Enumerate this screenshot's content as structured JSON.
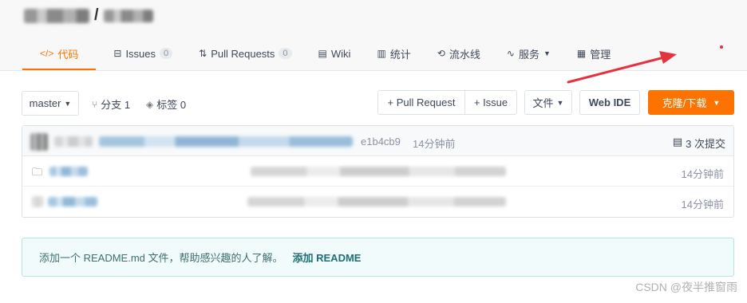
{
  "repo": {
    "separator": "/"
  },
  "tabs": [
    {
      "icon": "code-icon",
      "glyph": "</>",
      "label": "代码",
      "active": true
    },
    {
      "icon": "issues-icon",
      "glyph": "⊟",
      "label": "Issues",
      "count": "0"
    },
    {
      "icon": "pull-request-icon",
      "glyph": "⇅",
      "label": "Pull Requests",
      "count": "0"
    },
    {
      "icon": "wiki-icon",
      "glyph": "▤",
      "label": "Wiki"
    },
    {
      "icon": "stats-icon",
      "glyph": "▥",
      "label": "统计"
    },
    {
      "icon": "pipeline-icon",
      "glyph": "⟲",
      "label": "流水线"
    },
    {
      "icon": "service-icon",
      "glyph": "∿",
      "label": "服务"
    },
    {
      "icon": "manage-icon",
      "glyph": "▦",
      "label": "管理"
    }
  ],
  "toolbar": {
    "branch": "master",
    "branches_label": "分支 1",
    "tags_label": "标签 0",
    "pull_request_btn": "+ Pull Request",
    "issue_btn": "+ Issue",
    "file_btn": "文件",
    "web_ide_btn": "Web IDE",
    "clone_btn": "克隆/下载"
  },
  "commit": {
    "hash": "e1b4cb9",
    "time": "14分钟前",
    "commits_label": "3 次提交"
  },
  "files": [
    {
      "type": "folder",
      "time": "14分钟前"
    },
    {
      "type": "file",
      "time": "14分钟前"
    }
  ],
  "readme": {
    "message": "添加一个 README.md 文件，帮助感兴趣的人了解。",
    "link": "添加 README"
  },
  "watermark": "CSDN @夜半推窗雨",
  "colors": {
    "accent": "#fe7300",
    "annotation_arrow": "#e5323e"
  }
}
